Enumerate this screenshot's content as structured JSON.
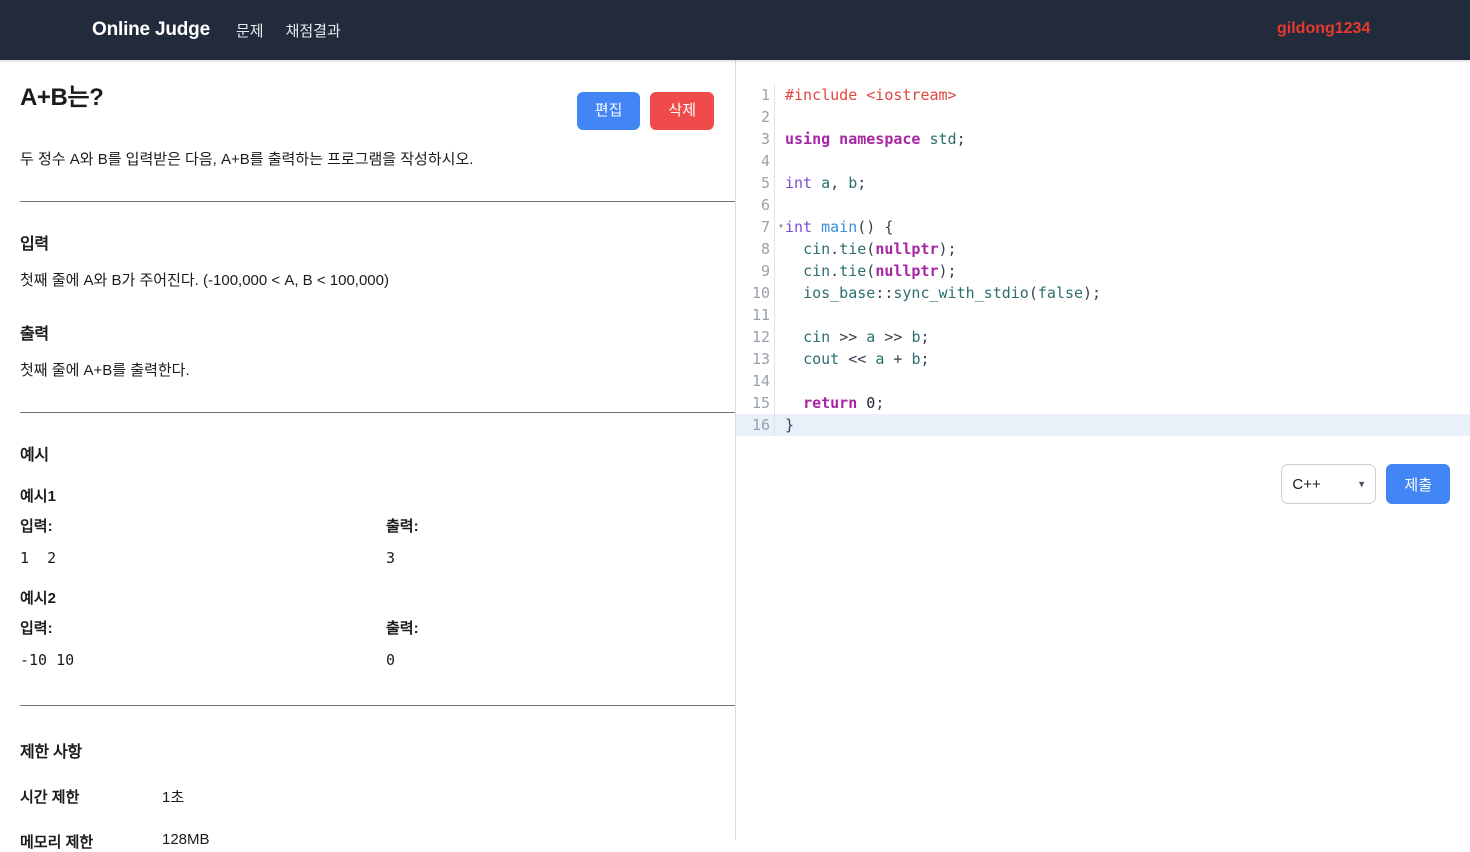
{
  "navbar": {
    "brand": "Online Judge",
    "links": [
      {
        "label": "문제"
      },
      {
        "label": "채점결과"
      }
    ],
    "username": "gildong1234",
    "username_color": "#e8392e",
    "background_color": "#212b3b"
  },
  "problem": {
    "title": "A+B는?",
    "description": "두 정수 A와 B를 입력받은 다음, A+B를 출력하는 프로그램을 작성하시오.",
    "edit_label": "편집",
    "delete_label": "삭제",
    "edit_color": "#4285f4",
    "delete_color": "#ef4b4b",
    "input_heading": "입력",
    "input_body": "첫째 줄에 A와 B가 주어진다. (-100,000 < A, B < 100,000)",
    "output_heading": "출력",
    "output_body": "첫째 줄에 A+B를 출력한다."
  },
  "examples": {
    "heading": "예시",
    "input_key": "입력:",
    "output_key": "출력:",
    "items": [
      {
        "label": "예시1",
        "input": "1  2",
        "output": "3"
      },
      {
        "label": "예시2",
        "input": "-10 10",
        "output": "0"
      }
    ]
  },
  "limits": {
    "heading": "제한 사항",
    "rows": [
      {
        "key": "시간 제한",
        "value": "1초"
      },
      {
        "key": "메모리 제한",
        "value": "128MB"
      }
    ]
  },
  "editor": {
    "active_line": 16,
    "active_line_color": "#eaf0fa",
    "line_numbers": [
      1,
      2,
      3,
      4,
      5,
      6,
      7,
      8,
      9,
      10,
      11,
      12,
      13,
      14,
      15,
      16
    ],
    "fold_line": 7,
    "lines": [
      "#include <iostream>",
      "",
      "using namespace std;",
      "",
      "int a, b;",
      "",
      "int main() {",
      "  cin.tie(nullptr);",
      "  cin.tie(nullptr);",
      "  ios_base::sync_with_stdio(false);",
      "",
      "  cin >> a >> b;",
      "  cout << a + b;",
      "",
      "  return 0;",
      "}"
    ]
  },
  "submit": {
    "language": "C++",
    "language_options": [
      "C++"
    ],
    "submit_label": "제출",
    "submit_color": "#4285f4"
  }
}
